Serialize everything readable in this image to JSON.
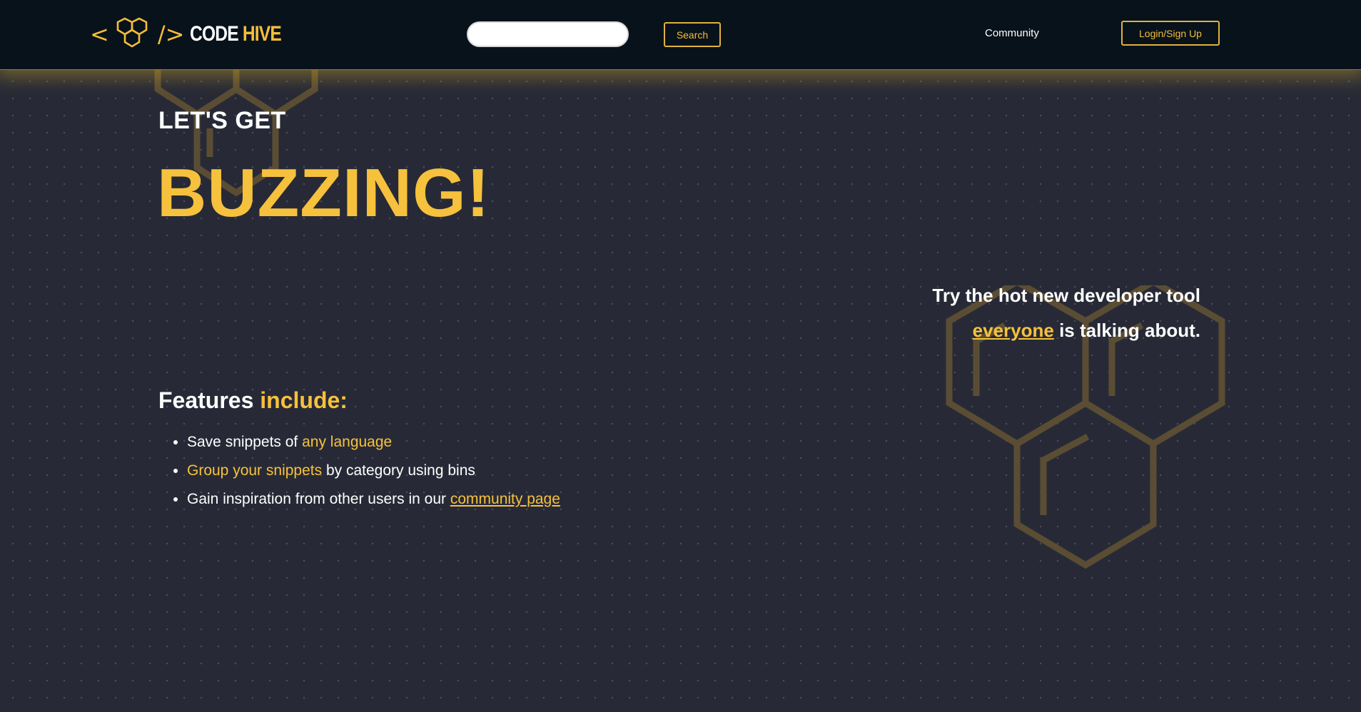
{
  "header": {
    "logo": {
      "bracket_open": "<",
      "bracket_close": "/>",
      "word_white": "CODE",
      "word_yellow": "HIVE",
      "icon": "honeycomb-icon"
    },
    "search": {
      "placeholder": "",
      "value": "",
      "button_label": "Search"
    },
    "nav": {
      "community": "Community",
      "login": "Login/Sign Up"
    }
  },
  "hero": {
    "kicker": "LET'S GET",
    "headline": "BUZZING!"
  },
  "tagline": {
    "line1": "Try the hot new developer tool",
    "link": "everyone",
    "line2_rest": "is talking about."
  },
  "features": {
    "title_white": "Features",
    "title_yellow": "include:",
    "items": [
      {
        "pre": "Save snippets of ",
        "highlight": "any language",
        "post": ""
      },
      {
        "pre": "",
        "highlight": "Group your snippets",
        "post": " by category using bins"
      },
      {
        "pre": "Gain inspiration from other users in our ",
        "link": "community page"
      }
    ]
  },
  "colors": {
    "accent": "#f6c13c",
    "header_bg": "#08121b",
    "page_bg": "#272a36",
    "deco": "#5a4d33"
  }
}
